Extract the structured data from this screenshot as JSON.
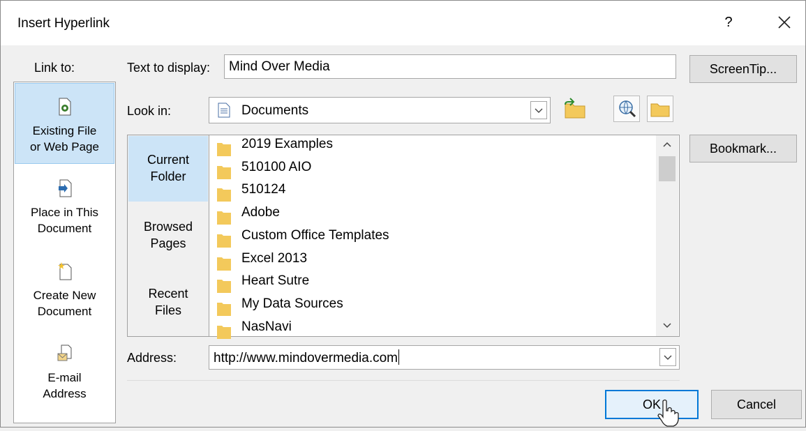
{
  "window": {
    "title": "Insert Hyperlink",
    "help_label": "?",
    "close_icon": "close-icon"
  },
  "link_to": {
    "label": "Link to:",
    "items": [
      {
        "line1": "Existing File",
        "line2": "or Web Page",
        "icon": "existing-file-icon",
        "selected": true
      },
      {
        "line1": "Place in This",
        "line2": "Document",
        "icon": "place-in-document-icon",
        "selected": false
      },
      {
        "line1": "Create New",
        "line2": "Document",
        "icon": "new-document-icon",
        "selected": false
      },
      {
        "line1": "E-mail",
        "line2": "Address",
        "icon": "email-address-icon",
        "selected": false
      }
    ]
  },
  "text_to_display": {
    "label": "Text to display:",
    "value": "Mind Over Media"
  },
  "screentip_label": "ScreenTip...",
  "look_in": {
    "label": "Look in:",
    "value": "Documents",
    "icon": "documents-icon"
  },
  "places": [
    {
      "line1": "Current",
      "line2": "Folder",
      "selected": true
    },
    {
      "line1": "Browsed",
      "line2": "Pages",
      "selected": false
    },
    {
      "line1": "Recent",
      "line2": "Files",
      "selected": false
    }
  ],
  "files": [
    "2019 Examples",
    "510100 AIO",
    "510124",
    "Adobe",
    "Custom Office Templates",
    "Excel 2013",
    "Heart Sutre",
    "My Data Sources",
    "NasNavi"
  ],
  "bookmark_label": "Bookmark...",
  "address": {
    "label": "Address:",
    "value": "http://www.mindovermedia.com"
  },
  "ok_label": "OK",
  "cancel_label": "Cancel",
  "colors": {
    "selection": "#cce4f7",
    "folder": "#f3c95b",
    "accent": "#0078d7"
  }
}
